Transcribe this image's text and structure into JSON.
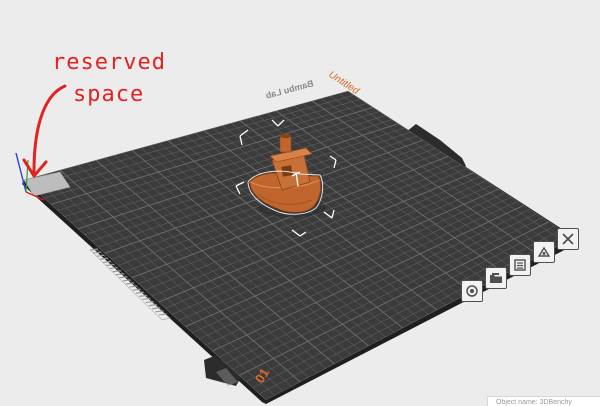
{
  "annotation": {
    "line1": "reserved",
    "line2": "space",
    "color": "#e32222"
  },
  "plate": {
    "name_label": "Untitled",
    "plate_number": "01",
    "brand_mark": "Bambu Lab",
    "plate_color": "#3b3b3b",
    "grid_color": "#6e6e6e",
    "label_color": "#d66a2c"
  },
  "model": {
    "name": "3DBenchy",
    "color": "#c0652d"
  },
  "plate_toolbar": {
    "buttons": [
      {
        "name": "plate-settings-button",
        "icon": "gear-icon"
      },
      {
        "name": "plate-lock-button",
        "icon": "folder-icon"
      },
      {
        "name": "plate-arrange-button",
        "icon": "arrange-icon"
      },
      {
        "name": "plate-orient-button",
        "icon": "orient-icon"
      },
      {
        "name": "plate-delete-button",
        "icon": "close-icon"
      }
    ]
  },
  "status": {
    "text": "Object name: 3DBenchy"
  }
}
